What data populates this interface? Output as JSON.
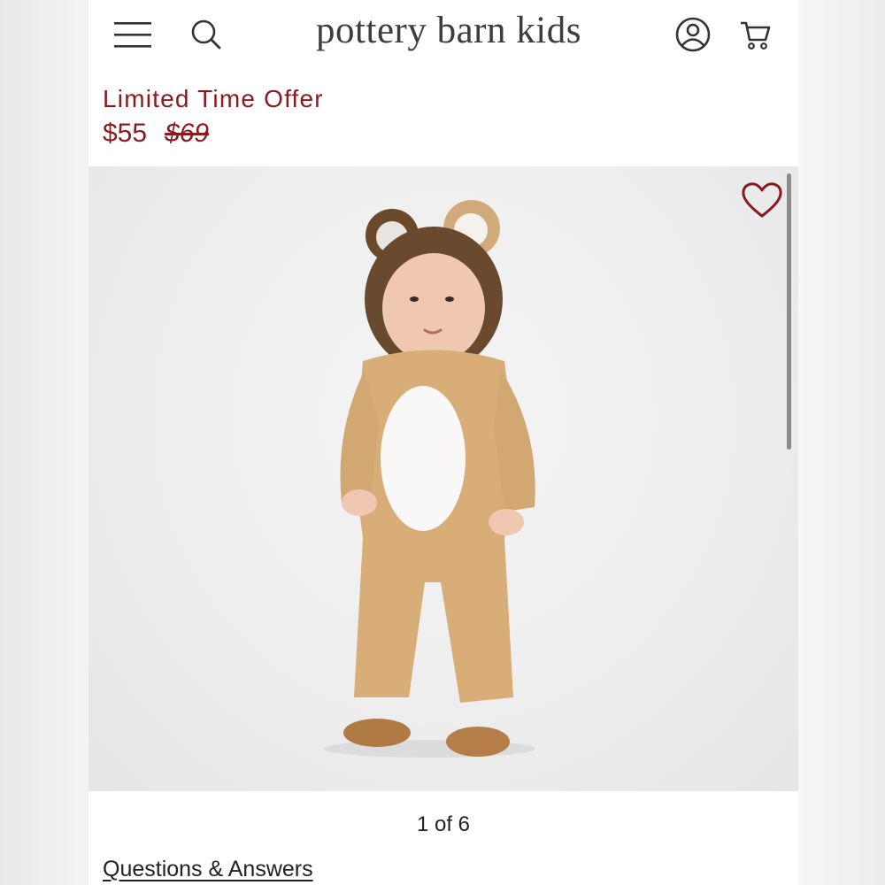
{
  "header": {
    "brand": "pottery barn kids",
    "icons": {
      "menu": "hamburger-menu-icon",
      "search": "search-icon",
      "account": "account-icon",
      "cart": "cart-icon"
    }
  },
  "product": {
    "offer_label": "Limited Time Offer",
    "sale_price": "$55",
    "original_price": "$69",
    "image": {
      "description_icon": "product-photo",
      "favorite_icon": "heart-icon"
    }
  },
  "gallery": {
    "counter": "1 of 6"
  },
  "links": {
    "questions": "Questions & Answers"
  },
  "colors": {
    "accent": "#8a1a1f",
    "brand_text": "#3d3d3d"
  }
}
